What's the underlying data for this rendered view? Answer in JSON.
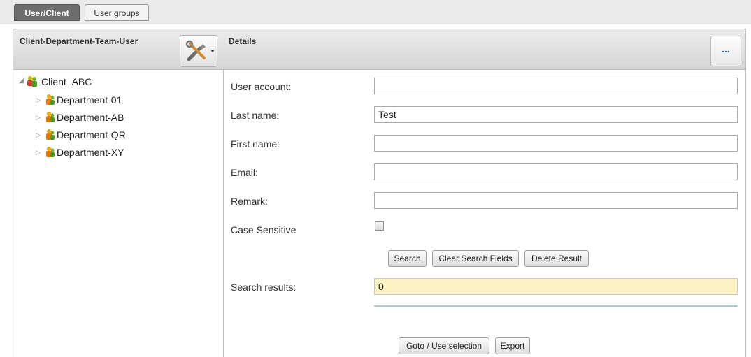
{
  "tabs": {
    "active": "User/Client",
    "inactive": "User groups"
  },
  "left_panel": {
    "title": "Client-Department-Team-User",
    "tree": {
      "root": "Client_ABC",
      "children": [
        "Department-01",
        "Department-AB",
        "Department-QR",
        "Department-XY"
      ]
    }
  },
  "details": {
    "title": "Details",
    "more_label": "...",
    "fields": {
      "user_account": {
        "label": "User account:",
        "value": ""
      },
      "last_name": {
        "label": "Last name:",
        "value": "Test"
      },
      "first_name": {
        "label": "First name:",
        "value": ""
      },
      "email": {
        "label": "Email:",
        "value": ""
      },
      "remark": {
        "label": "Remark:",
        "value": ""
      }
    },
    "case_sensitive_label": "Case Sensitive",
    "buttons": {
      "search": "Search",
      "clear": "Clear Search Fields",
      "delete": "Delete Result",
      "goto": "Goto / Use selection",
      "export": "Export"
    },
    "search_results_label": "Search results:",
    "search_results_value": "0"
  }
}
